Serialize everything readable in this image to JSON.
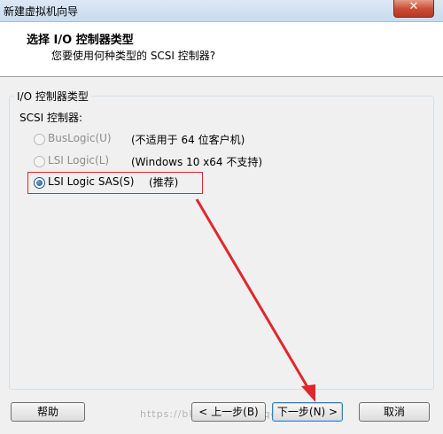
{
  "window": {
    "title": "新建虚拟机向导",
    "close_label": "✕"
  },
  "header": {
    "title": "选择 I/O 控制器类型",
    "subtitle": "您要使用何种类型的 SCSI 控制器?"
  },
  "group": {
    "legend": "I/O 控制器类型",
    "sub_label": "SCSI 控制器:"
  },
  "options": [
    {
      "label": "BusLogic(U)",
      "note": "(不适用于 64 位客户机)",
      "enabled": false,
      "checked": false
    },
    {
      "label": "LSI Logic(L)",
      "note": "(Windows 10 x64 不支持)",
      "enabled": false,
      "checked": false
    },
    {
      "label": "LSI Logic SAS(S)",
      "note": "(推荐)",
      "enabled": true,
      "checked": true
    }
  ],
  "buttons": {
    "help": "帮助",
    "back": "< 上一步(B)",
    "next": "下一步(N) >",
    "cancel": "取消"
  },
  "watermark": "https://blog.csdn.net/qq_42...456",
  "colors": {
    "highlight": "#e0272b",
    "arrow": "#e0272b"
  }
}
